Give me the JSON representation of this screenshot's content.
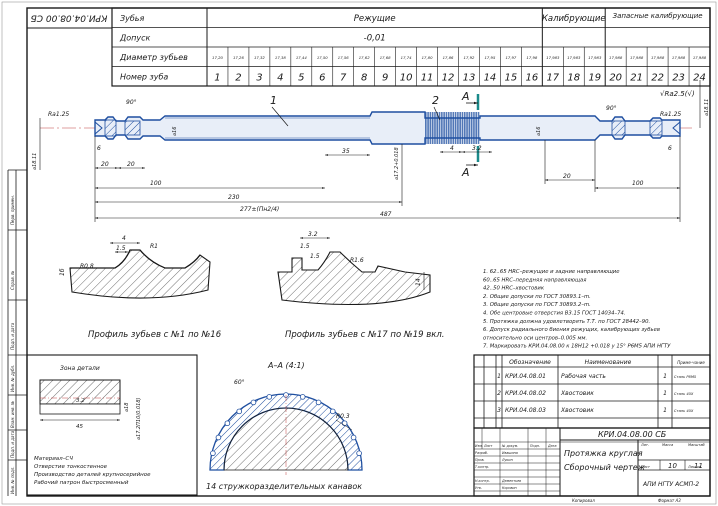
{
  "drawing_number": "КРИ.04.08.00 СБ",
  "drawing_number_rotated": "КРИ.04.08.00 СБ",
  "tooth_table": {
    "row_labels": [
      "Зубья",
      "Допуск",
      "Диаметр зубьев",
      "Номер зуба"
    ],
    "groups": [
      {
        "name": "Режущие",
        "tolerance": "-0,01"
      },
      {
        "name": "Калибрующие",
        "tolerance": ""
      },
      {
        "name": "Запасные калибрующие",
        "tolerance": ""
      }
    ],
    "diameters": [
      "17,20",
      "17,26",
      "17,32",
      "17,38",
      "17,44",
      "17,50",
      "17,56",
      "17,62",
      "17,68",
      "17,74",
      "17,80",
      "17,86",
      "17,92",
      "17,95",
      "17,97",
      "17,98",
      "17,983",
      "17,983",
      "17,983",
      "17,988",
      "17,988",
      "17,988",
      "17,988",
      "17,988"
    ],
    "numbers": [
      "1",
      "2",
      "3",
      "4",
      "5",
      "6",
      "7",
      "8",
      "9",
      "10",
      "11",
      "12",
      "13",
      "14",
      "15",
      "16",
      "17",
      "18",
      "19",
      "20",
      "21",
      "22",
      "23",
      "24"
    ]
  },
  "main_view": {
    "roughness": "√Ra2.5(√)",
    "dims": {
      "d1": "20",
      "d2": "20",
      "d3": "100",
      "d4": "230",
      "d5": "277±(Пн2/4)",
      "d6": "487",
      "d7": "35",
      "d8": "4",
      "d9": "3.2",
      "d10": "20",
      "d11": "100",
      "d12": "6",
      "d13": "6",
      "angle_left": "90°",
      "angle_right": "90°",
      "ra_left": "Ra1.25",
      "ra_right": "Ra1.25",
      "dia1": "⌀16",
      "dia2": "⌀17.2+0.018",
      "dia3": "⌀16",
      "dia4": "⌀16",
      "vert_left": "⌀18.11",
      "vert_right": "⌀18.11"
    },
    "callout1": "1",
    "callout2": "2",
    "section_mark": "А"
  },
  "profile_left": {
    "title": "Профиль зубьев с №1 по №16",
    "dims": [
      "4",
      "1.5",
      "R0.8",
      "1б",
      "R1"
    ]
  },
  "profile_right": {
    "title": "Профиль зубьев с №17 по №19 вкл.",
    "dims": [
      "3.2",
      "1.5",
      "R1.6",
      "1.5",
      "14"
    ]
  },
  "section_view": {
    "title": "А–А (4:1)",
    "angle": "60°",
    "radius": "R0.3",
    "caption": "14 стружкоразделительных канавок"
  },
  "notes": [
    "1. 62..65 HRC–режущие и задние направляющие",
    "    60..65 HRC–передняя направляющая",
    "    42..50 HRC–хвостовик",
    "2. Общие допуски по ГОСТ 30893.1–m.",
    "3. Общие допуски по ГОСТ 30893.2–m.",
    "4. Обе центровые отверстия В3.15 ГОСТ 14034–74.",
    "5. Протяжка должна удовлетворять Т.Т. по ГОСТ 28442–90.",
    "6. Допуск радиального биения режущих, калибрующих зубьев",
    "    относительно оси центров–0.005 мм.",
    "7. Маркировать КРИ.04.08.00 к 18Н12 +0.018 у 15° Р6М5 АПИ НГТУ"
  ],
  "weld_zone": {
    "title": "Зона детали",
    "dims": [
      "3.2",
      "45",
      "⌀18",
      "⌀17.2П10(0.018)"
    ],
    "material": [
      "Материал–СЧ",
      "Отверстие тонкостенное",
      "Производство деталей крупносерийное",
      "Рабочий патрон быстросменный"
    ]
  },
  "parts_list": {
    "headers": [
      "Обозначение",
      "Наименование",
      "Приме-чание"
    ],
    "rows": [
      {
        "pos": "1",
        "designation": "КРИ.04.08.01",
        "name": "Рабочая часть",
        "qty": "1",
        "note": "Сталь Р6М5"
      },
      {
        "pos": "2",
        "designation": "КРИ.04.08.02",
        "name": "Хвостовик",
        "qty": "1",
        "note": "Сталь 40Х"
      },
      {
        "pos": "3",
        "designation": "КРИ.04.08.03",
        "name": "Хвостовик",
        "qty": "1",
        "note": "Сталь 40Х"
      }
    ]
  },
  "title_block": {
    "code": "КРИ.04.08.00 СБ",
    "name_line1": "Протяжка круглая",
    "name_line2": "Сборочный чертеж",
    "org": "АПИ НГТУ АСМП-2",
    "sheet": "10",
    "sheets": "11",
    "copied": "Копировал",
    "format": "Формат А3",
    "roles": [
      "Изм.",
      "Лист",
      "№ докум.",
      "Подп.",
      "Дата",
      "Разраб.",
      "Пров.",
      "Т.контр.",
      "Н.контр.",
      "Утв."
    ],
    "names": [
      "Ивашина",
      "Лукин",
      "Дементьев",
      "Коровин"
    ],
    "lit": "Лит.",
    "massa": "Масса",
    "masht": "Масштаб",
    "list_label": "Лист",
    "lists_label": "Листов"
  },
  "left_strip": [
    "Перв. примен.",
    "Справ. №",
    "Подп. и дата",
    "Инв. № дубл.",
    "Взам. инв. №",
    "Подп. и дата",
    "Инв. № подл."
  ]
}
